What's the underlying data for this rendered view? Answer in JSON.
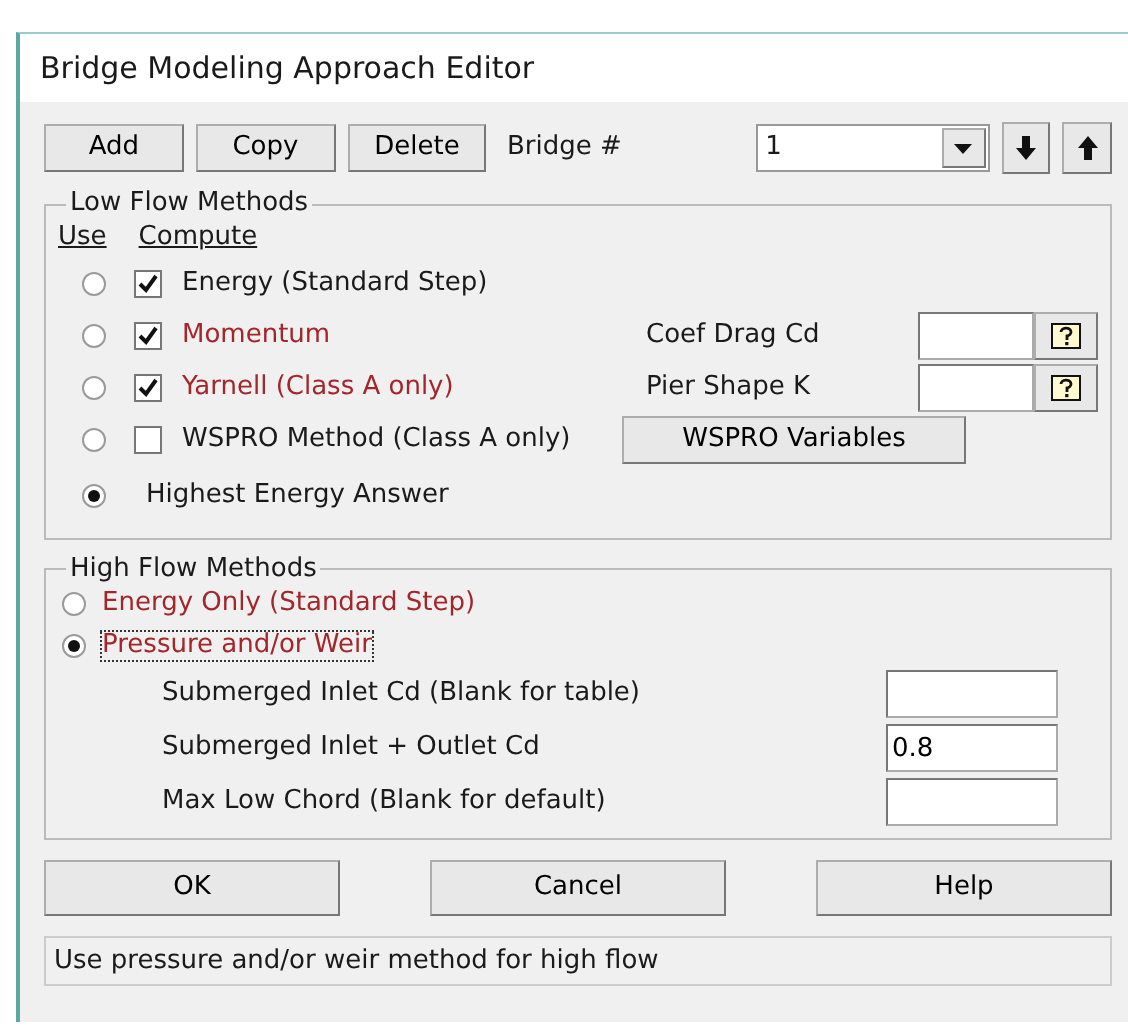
{
  "window": {
    "title": "Bridge Modeling Approach Editor"
  },
  "toolbar": {
    "buttons": [
      "Add",
      "Copy",
      "Delete"
    ],
    "bridge_label": "Bridge #",
    "bridge_select": {
      "value": "1"
    }
  },
  "low_flow": {
    "title": "Low Flow Methods",
    "use_header": "Use",
    "compute_header": "Compute",
    "methods": [
      {
        "kind": "method",
        "label": "Energy (Standard Step)",
        "color": "#1a1a1a",
        "selected": false,
        "checked": true
      },
      {
        "kind": "method",
        "label": "Momentum",
        "color": "#a3262a",
        "selected": false,
        "checked": true,
        "extra": {
          "kind": "field",
          "label": "Coef Drag Cd"
        }
      },
      {
        "kind": "method",
        "label": "Yarnell (Class A only)",
        "color": "#a3262a",
        "selected": false,
        "checked": true,
        "extra": {
          "kind": "field",
          "label": "Pier Shape K"
        }
      },
      {
        "kind": "method",
        "label": "WSPRO Method (Class A only)",
        "color": "#1a1a1a",
        "selected": false,
        "checked": false,
        "extra": {
          "kind": "button",
          "label": "WSPRO Variables"
        }
      },
      {
        "kind": "answer",
        "label": "Highest Energy Answer",
        "color": "#1a1a1a",
        "selected": true
      }
    ]
  },
  "high_flow": {
    "title": "High Flow Methods",
    "options": [
      {
        "label": "Energy Only (Standard Step)",
        "selected": false,
        "focused": false
      },
      {
        "label": "Pressure and/or Weir",
        "selected": true,
        "focused": true
      }
    ],
    "fields": [
      {
        "label": "Submerged Inlet Cd (Blank for table)"
      },
      {
        "label": "Submerged Inlet + Outlet Cd",
        "value": "0.8"
      },
      {
        "label": "Max Low Chord (Blank for default)"
      }
    ]
  },
  "buttons": [
    "OK",
    "Cancel",
    "Help"
  ],
  "status_bar": "Use pressure and/or weir method for high flow"
}
